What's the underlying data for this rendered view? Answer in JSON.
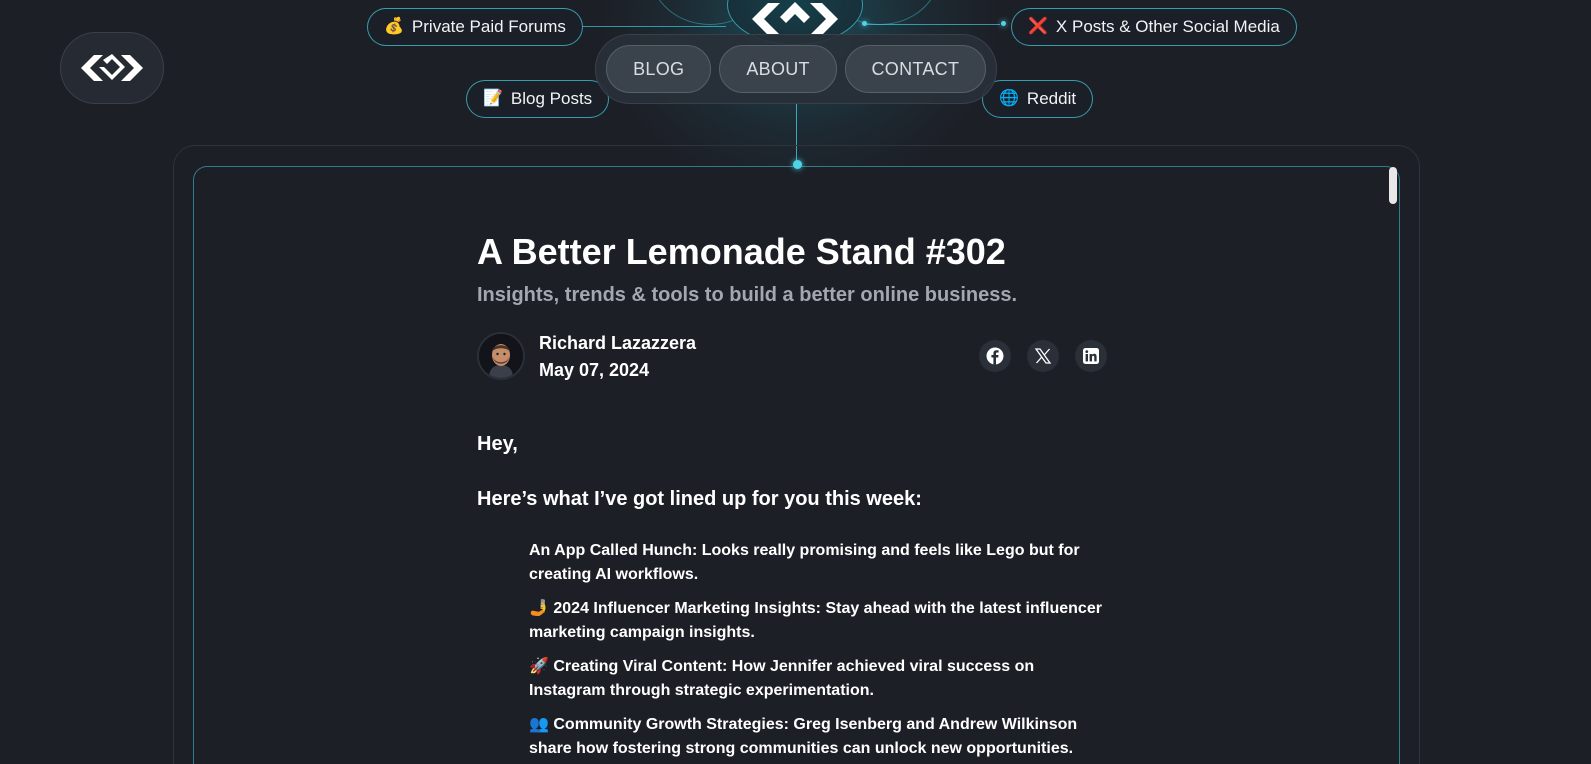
{
  "nav": {
    "items": [
      "BLOG",
      "ABOUT",
      "CONTACT"
    ]
  },
  "sources": {
    "forums": {
      "emoji": "💰",
      "label": "Private Paid Forums"
    },
    "blog_posts": {
      "emoji": "📝",
      "label": "Blog Posts"
    },
    "social": {
      "emoji": "❌",
      "label": "X Posts & Other Social Media"
    },
    "reddit": {
      "emoji": "🌐",
      "label": "Reddit"
    }
  },
  "article": {
    "title": "A Better Lemonade Stand #302",
    "subtitle": "Insights, trends & tools to build a better online business.",
    "author": "Richard Lazazzera",
    "date": "May 07, 2024",
    "greeting": "Hey,",
    "lead": "Here’s what I’ve got lined up for you this week:",
    "items": [
      "An App Called Hunch: Looks really promising and feels like Lego but for creating AI workflows.",
      "🤳 2024 Influencer Marketing Insights: Stay ahead with the latest influencer marketing campaign insights.",
      "🚀 Creating Viral Content: How Jennifer achieved viral success on Instagram through strategic experimentation.",
      "👥 Community Growth Strategies: Greg Isenberg and Andrew Wilkinson share how fostering strong communities can unlock new opportunities."
    ]
  },
  "share_icons": [
    "facebook-icon",
    "x-icon",
    "linkedin-icon"
  ],
  "colors": {
    "background": "#1d1f26",
    "accent": "#40c8dc",
    "muted_text": "#a2a7b0"
  }
}
